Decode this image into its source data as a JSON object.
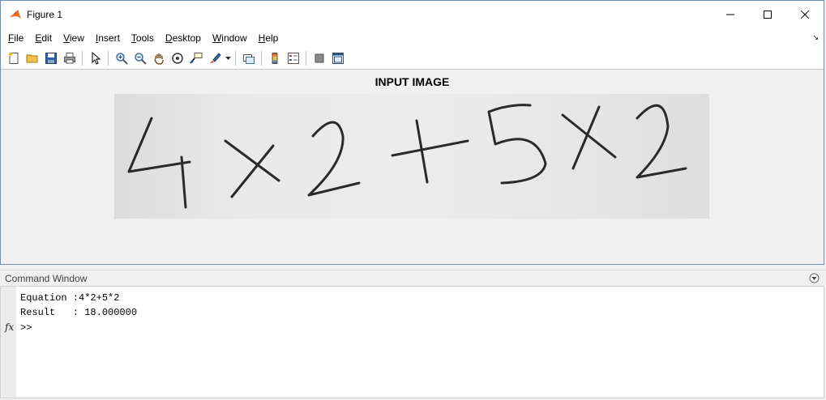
{
  "window": {
    "title": "Figure 1",
    "controls": [
      "minimize-icon",
      "maximize-icon",
      "close-icon"
    ]
  },
  "menu": {
    "items": [
      "File",
      "Edit",
      "View",
      "Insert",
      "Tools",
      "Desktop",
      "Window",
      "Help"
    ],
    "corner_glyph": "↘"
  },
  "toolbar": {
    "buttons": [
      "new-figure-icon",
      "open-icon",
      "save-icon",
      "print-icon",
      "edit-plot-icon",
      "zoom-in-icon",
      "zoom-out-icon",
      "pan-icon",
      "rotate-3d-icon",
      "data-cursor-icon",
      "brush-icon",
      "link-plot-icon",
      "insert-colorbar-icon",
      "insert-legend-icon",
      "hide-plot-tools-icon",
      "show-plot-tools-icon"
    ]
  },
  "figure": {
    "axes_title": "INPUT IMAGE",
    "image_content": "4x2+5x2"
  },
  "command_window": {
    "header": "Command Window",
    "lines": [
      "Equation :4*2+5*2",
      "Result   : 18.000000"
    ],
    "prompt": ">>",
    "fx_label": "fx"
  }
}
